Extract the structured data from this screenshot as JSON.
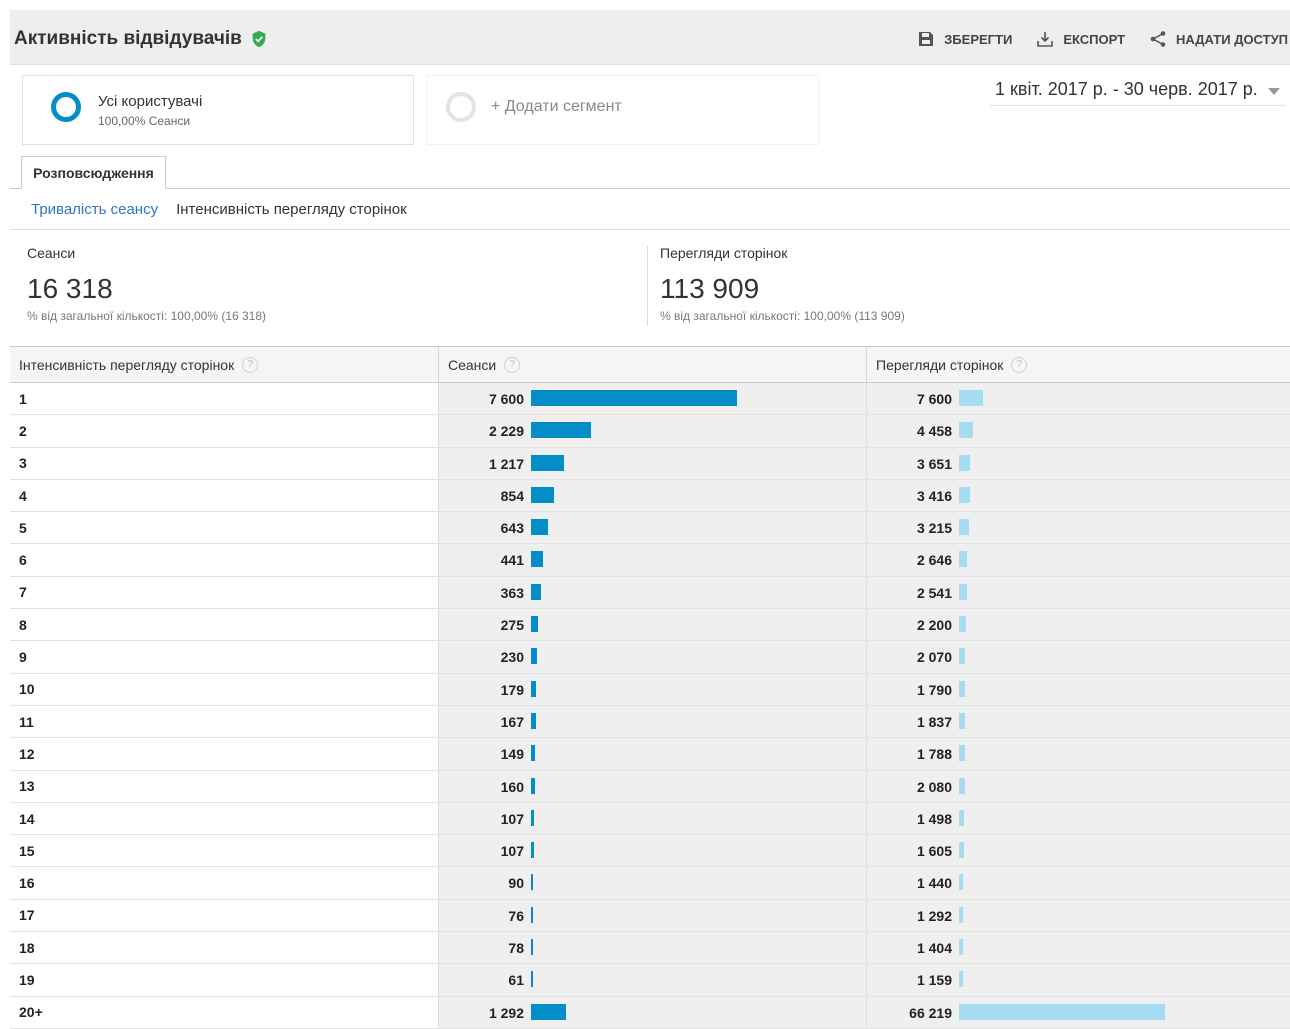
{
  "header": {
    "title": "Активність відвідувачів",
    "actions": {
      "save": "ЗБЕРЕГТИ",
      "export": "ЕКСПОРТ",
      "share": "НАДАТИ ДОСТУП"
    }
  },
  "segments": {
    "active": {
      "name": "Усі користувачі",
      "sub": "100,00% Сеанси"
    },
    "add": "+ Додати сегмент"
  },
  "date_range": "1 квіт. 2017 р. - 30 черв. 2017 р.",
  "tabs": {
    "distribution": "Розповсюдження"
  },
  "subnav": {
    "duration": "Тривалість сеансу",
    "depth": "Інтенсивність перегляду сторінок"
  },
  "metrics": {
    "sessions": {
      "label": "Сеанси",
      "value": "16 318",
      "pct": "% від загальної кількості: 100,00% (16 318)"
    },
    "pageviews": {
      "label": "Перегляди сторінок",
      "value": "113 909",
      "pct": "% від загальної кількості: 100,00% (113 909)"
    }
  },
  "table": {
    "headers": {
      "depth": "Інтенсивність перегляду сторінок",
      "sessions": "Сеанси",
      "pageviews": "Перегляди сторінок"
    },
    "help_glyph": "?",
    "colors": {
      "sessions_bar": "#058dc7",
      "pageviews_bar": "#a6dcf3"
    },
    "rows": [
      {
        "depth": "1",
        "sessions": "7 600",
        "s": 7600,
        "pageviews": "7 600",
        "p": 7600
      },
      {
        "depth": "2",
        "sessions": "2 229",
        "s": 2229,
        "pageviews": "4 458",
        "p": 4458
      },
      {
        "depth": "3",
        "sessions": "1 217",
        "s": 1217,
        "pageviews": "3 651",
        "p": 3651
      },
      {
        "depth": "4",
        "sessions": "854",
        "s": 854,
        "pageviews": "3 416",
        "p": 3416
      },
      {
        "depth": "5",
        "sessions": "643",
        "s": 643,
        "pageviews": "3 215",
        "p": 3215
      },
      {
        "depth": "6",
        "sessions": "441",
        "s": 441,
        "pageviews": "2 646",
        "p": 2646
      },
      {
        "depth": "7",
        "sessions": "363",
        "s": 363,
        "pageviews": "2 541",
        "p": 2541
      },
      {
        "depth": "8",
        "sessions": "275",
        "s": 275,
        "pageviews": "2 200",
        "p": 2200
      },
      {
        "depth": "9",
        "sessions": "230",
        "s": 230,
        "pageviews": "2 070",
        "p": 2070
      },
      {
        "depth": "10",
        "sessions": "179",
        "s": 179,
        "pageviews": "1 790",
        "p": 1790
      },
      {
        "depth": "11",
        "sessions": "167",
        "s": 167,
        "pageviews": "1 837",
        "p": 1837
      },
      {
        "depth": "12",
        "sessions": "149",
        "s": 149,
        "pageviews": "1 788",
        "p": 1788
      },
      {
        "depth": "13",
        "sessions": "160",
        "s": 160,
        "pageviews": "2 080",
        "p": 2080
      },
      {
        "depth": "14",
        "sessions": "107",
        "s": 107,
        "pageviews": "1 498",
        "p": 1498
      },
      {
        "depth": "15",
        "sessions": "107",
        "s": 107,
        "pageviews": "1 605",
        "p": 1605
      },
      {
        "depth": "16",
        "sessions": "90",
        "s": 90,
        "pageviews": "1 440",
        "p": 1440
      },
      {
        "depth": "17",
        "sessions": "76",
        "s": 76,
        "pageviews": "1 292",
        "p": 1292
      },
      {
        "depth": "18",
        "sessions": "78",
        "s": 78,
        "pageviews": "1 404",
        "p": 1404
      },
      {
        "depth": "19",
        "sessions": "61",
        "s": 61,
        "pageviews": "1 159",
        "p": 1159
      },
      {
        "depth": "20+",
        "sessions": "1 292",
        "s": 1292,
        "pageviews": "66 219",
        "p": 66219
      }
    ]
  }
}
